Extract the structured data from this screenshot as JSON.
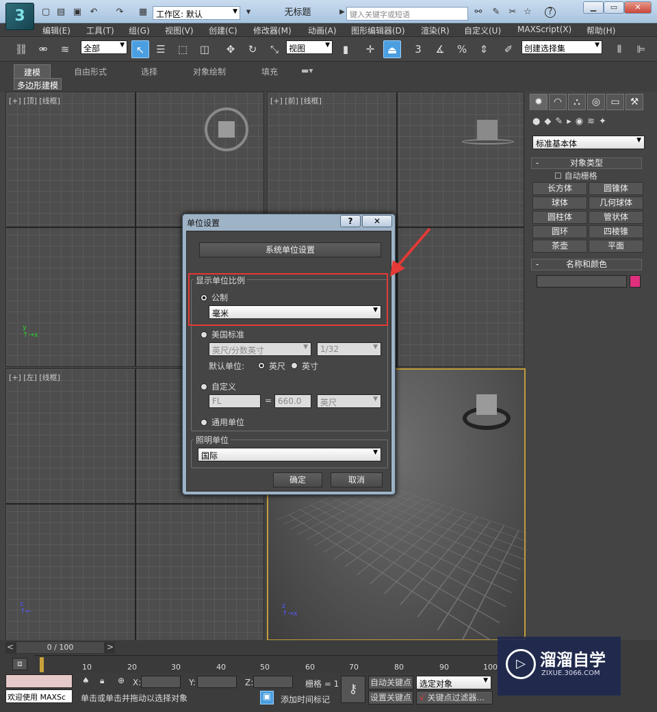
{
  "app": {
    "title": "无标题",
    "logo_letter": "3"
  },
  "workspace": {
    "label": "工作区: 默认"
  },
  "search": {
    "placeholder": "键入关键字或短语"
  },
  "menus": [
    "编辑(E)",
    "工具(T)",
    "组(G)",
    "视图(V)",
    "创建(C)",
    "修改器(M)",
    "动画(A)",
    "图形编辑器(D)",
    "渲染(R)",
    "自定义(U)",
    "MAXScript(X)",
    "帮助(H)"
  ],
  "toolbar": {
    "filter": "全部",
    "refcoord": "视图",
    "snap_num": "3",
    "selset": "创建选择集"
  },
  "ribbon": {
    "tabs": [
      "建模",
      "自由形式",
      "选择",
      "对象绘制",
      "填充"
    ],
    "subtab": "多边形建模"
  },
  "viewports": {
    "top": "[+] [顶] [线框]",
    "front": "[+] [前] [线框]",
    "left": "[+] [左] [线框]"
  },
  "command_panel": {
    "category": "标准基本体",
    "rollout_object_type": "对象类型",
    "autogrid": "自动栅格",
    "buttons": [
      "长方体",
      "圆锥体",
      "球体",
      "几何球体",
      "圆柱体",
      "管状体",
      "圆环",
      "四棱锥",
      "茶壶",
      "平面"
    ],
    "rollout_name_color": "名称和颜色",
    "object_color": "#e0307d"
  },
  "timeline": {
    "frame": "0 / 100",
    "ticks": [
      "10",
      "20",
      "30",
      "40",
      "50",
      "60",
      "70",
      "80",
      "90",
      "100"
    ]
  },
  "status": {
    "welcome": "欢迎使用 MAXSc",
    "prompt": "单击或单击并拖动以选择对象",
    "x_label": "X:",
    "y_label": "Y:",
    "z_label": "Z:",
    "grid": "栅格 = 1",
    "add_time_tag": "添加时间标记",
    "auto_key": "自动关键点",
    "set_key": "设置关键点",
    "selected": "选定对象",
    "key_filters": "关键点过滤器..."
  },
  "dialog": {
    "title": "单位设置",
    "help": "?",
    "close": "✕",
    "system_button": "系统单位设置",
    "display_group": "显示单位比例",
    "metric": "公制",
    "metric_unit": "毫米",
    "us_standard": "美国标准",
    "us_unit": "英尺/分数英寸",
    "us_fraction": "1/32",
    "default_unit_label": "默认单位:",
    "feet": "英尺",
    "inches": "英寸",
    "custom": "自定义",
    "custom_name": "FL",
    "equals": "=",
    "custom_value": "660.0",
    "custom_unit": "英尺",
    "generic": "通用单位",
    "lighting_group": "照明单位",
    "lighting_unit": "国际",
    "ok": "确定",
    "cancel": "取消"
  },
  "watermark": {
    "brand": "溜溜自学",
    "url": "ZIXUE.3066.COM"
  }
}
